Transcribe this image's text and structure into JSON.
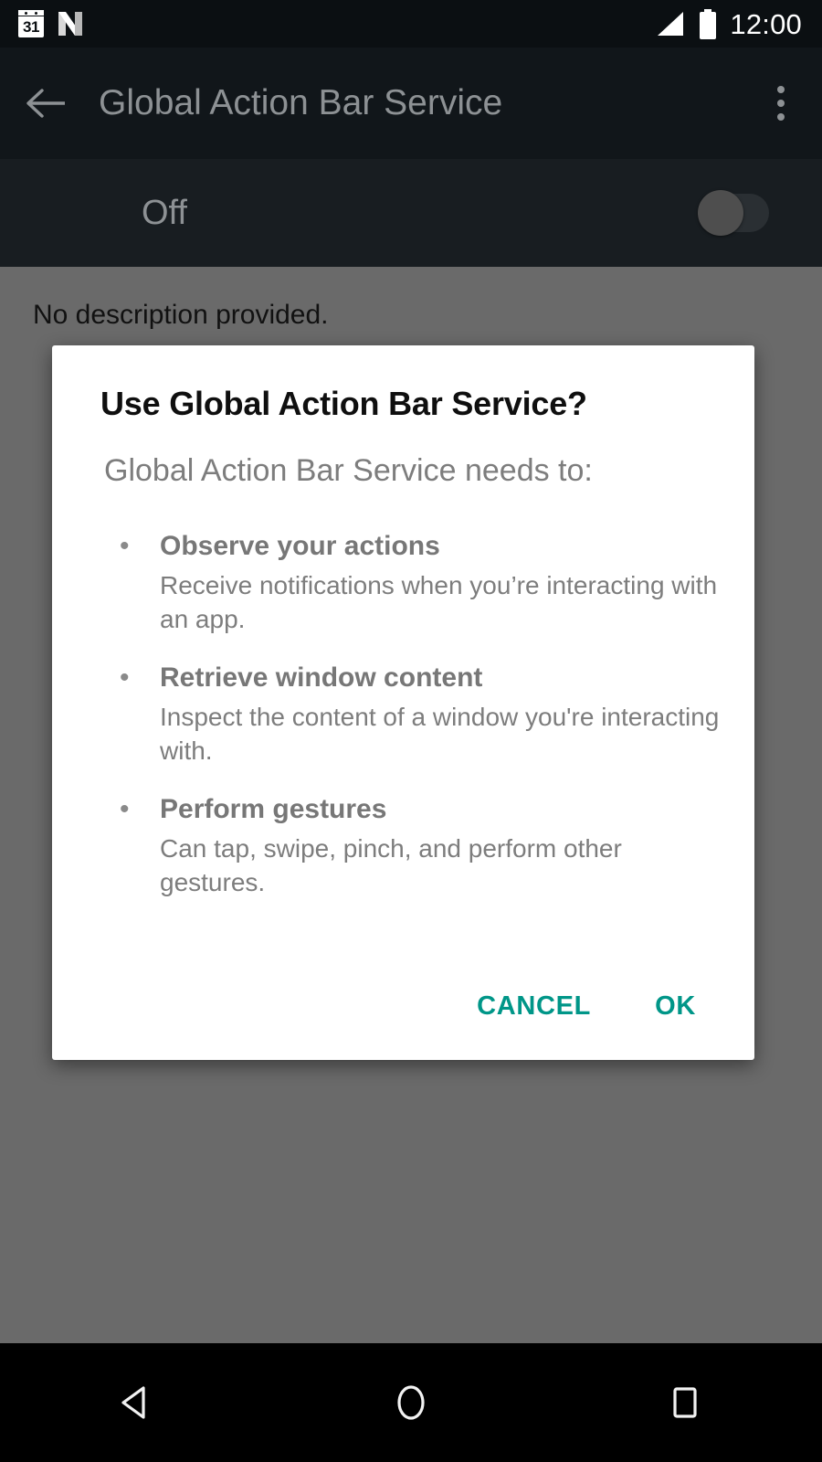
{
  "status_bar": {
    "calendar_day": "31",
    "clock": "12:00",
    "icons": [
      "calendar-icon",
      "android-n-icon",
      "signal-icon",
      "battery-icon"
    ]
  },
  "app_bar": {
    "back_label": "back-arrow-icon",
    "title": "Global Action Bar Service",
    "overflow_label": "overflow-menu-icon"
  },
  "toggle_row": {
    "label": "Off",
    "state": "off"
  },
  "content": {
    "description": "No description provided."
  },
  "dialog": {
    "title": "Use Global Action Bar Service?",
    "subtitle": "Global Action Bar Service needs to:",
    "permissions": [
      {
        "title": "Observe your actions",
        "description": "Receive notifications when you’re interacting with an app."
      },
      {
        "title": "Retrieve window content",
        "description": "Inspect the content of a window you're interacting with."
      },
      {
        "title": "Perform gestures",
        "description": "Can tap, swipe, pinch, and perform other gestures."
      }
    ],
    "cancel_label": "CANCEL",
    "ok_label": "OK",
    "accent_color": "#009688"
  },
  "nav_bar": {
    "back": "nav-back-icon",
    "home": "nav-home-icon",
    "recents": "nav-recents-icon"
  },
  "colors": {
    "app_bar_bg": "#11161a",
    "toggle_row_bg": "#181d21",
    "scrim": "#6a6a6a",
    "accent": "#009688",
    "status_bar_bg": "#0b0f12"
  }
}
